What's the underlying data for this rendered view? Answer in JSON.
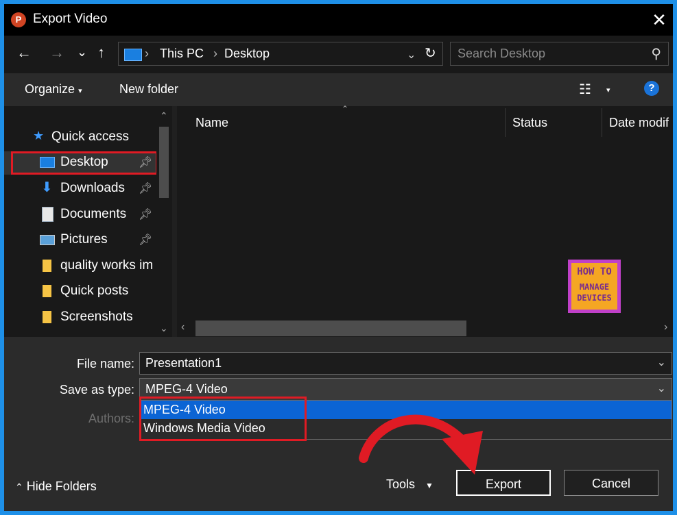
{
  "window": {
    "title": "Export Video",
    "app_icon": "powerpoint-icon"
  },
  "nav": {
    "back_icon": "←",
    "forward_icon": "→",
    "recent_icon": "⌄",
    "up_icon": "↑",
    "breadcrumb": [
      "This PC",
      "Desktop"
    ],
    "refresh_icon": "↻",
    "search_placeholder": "Search Desktop"
  },
  "toolbar": {
    "organize": "Organize",
    "new_folder": "New folder",
    "help": "?"
  },
  "sidebar": {
    "quick_access": "Quick access",
    "items": [
      {
        "label": "Desktop",
        "icon": "desktop-icon",
        "pinned": true
      },
      {
        "label": "Downloads",
        "icon": "download-arrow-icon",
        "pinned": true
      },
      {
        "label": "Documents",
        "icon": "document-icon",
        "pinned": true
      },
      {
        "label": "Pictures",
        "icon": "pictures-icon",
        "pinned": true
      },
      {
        "label": "quality works im",
        "icon": "folder-icon",
        "pinned": false
      },
      {
        "label": "Quick posts",
        "icon": "folder-icon",
        "pinned": false
      },
      {
        "label": "Screenshots",
        "icon": "folder-icon",
        "pinned": false
      }
    ]
  },
  "columns": [
    "Name",
    "Status",
    "Date modif"
  ],
  "logo": {
    "line1": "HOW TO",
    "line2": "MANAGE",
    "line3": "DEVICES"
  },
  "form": {
    "file_name_label": "File name:",
    "file_name_value": "Presentation1",
    "save_type_label": "Save as type:",
    "save_type_value": "MPEG-4 Video",
    "authors_label": "Authors:",
    "options": [
      "MPEG-4 Video",
      "Windows Media Video"
    ]
  },
  "footer": {
    "hide_folders": "Hide Folders",
    "tools": "Tools",
    "export": "Export",
    "cancel": "Cancel"
  },
  "colors": {
    "accent": "#0b64d4",
    "highlight_box": "#e01b24",
    "arrow": "#e01b24",
    "border": "#1e90e8"
  }
}
